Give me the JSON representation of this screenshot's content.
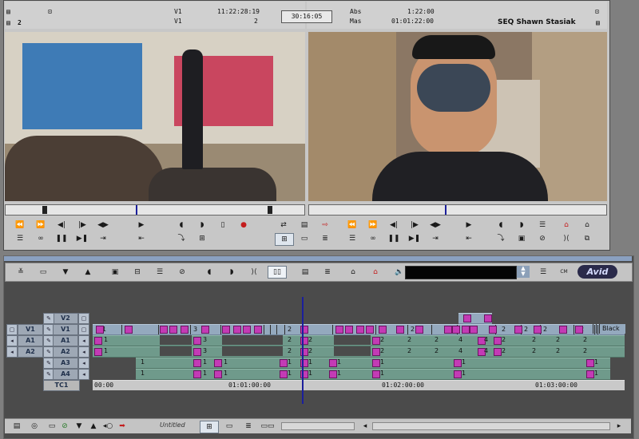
{
  "source_window": {
    "status_left_top": "2",
    "v1_label": "V1",
    "timecode_1": "11:22:28:19",
    "v1_label_2": "V1",
    "number_2": "2",
    "center_timecode": "30:16:05",
    "abs_label": "Abs",
    "abs_value": "1:22:00",
    "mas_label": "Mas",
    "mas_value": "01:01:22:00",
    "sequence_title": "SEQ Shawn Stasiak"
  },
  "timeline": {
    "brand": "Avid",
    "tracks": {
      "v2": "V2",
      "v1": "V1",
      "a1": "A1",
      "a2": "A2",
      "a3": "A3",
      "a4": "A4",
      "tc1": "TC1"
    },
    "v1_src": "V1",
    "a1_src": "A1",
    "a2_src": "A2",
    "v1_end_label": "Black",
    "timecodes": [
      "00:00",
      "01:01:00:00",
      "01:02:00:00",
      "01:03:00:00"
    ],
    "footer_title": "Untitled"
  },
  "colors": {
    "accent_blue": "#1b1f9c",
    "timeline_bg": "#4c4c4c",
    "audio_track": "#6f9a8b",
    "video_track": "#94a9be",
    "clip_marker": "#c33bb5"
  }
}
